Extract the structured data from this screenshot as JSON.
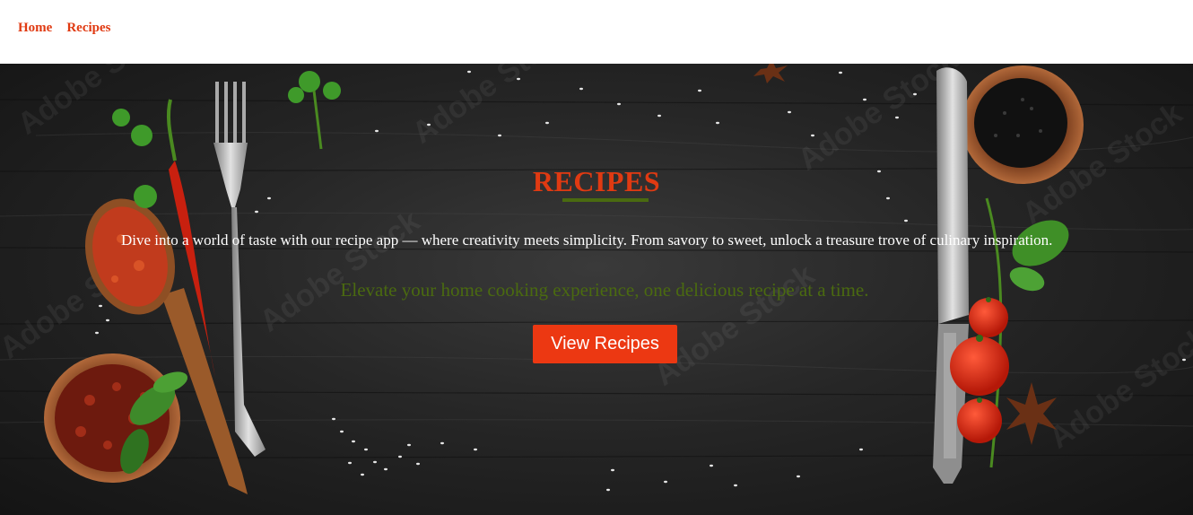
{
  "nav": {
    "items": [
      {
        "label": "Home"
      },
      {
        "label": "Recipes"
      }
    ]
  },
  "hero": {
    "title": "RECIPES",
    "description": "Dive into a world of taste with our recipe app — where creativity meets simplicity. From savory to sweet, unlock a treasure trove of culinary inspiration.",
    "tagline": "Elevate your home cooking experience, one delicious recipe at a time.",
    "cta_label": "View Recipes",
    "watermark": "Adobe Stock"
  },
  "colors": {
    "accent": "#e03a12",
    "button": "#ec3812",
    "tagline": "#4a6a10",
    "background": "#262626"
  }
}
